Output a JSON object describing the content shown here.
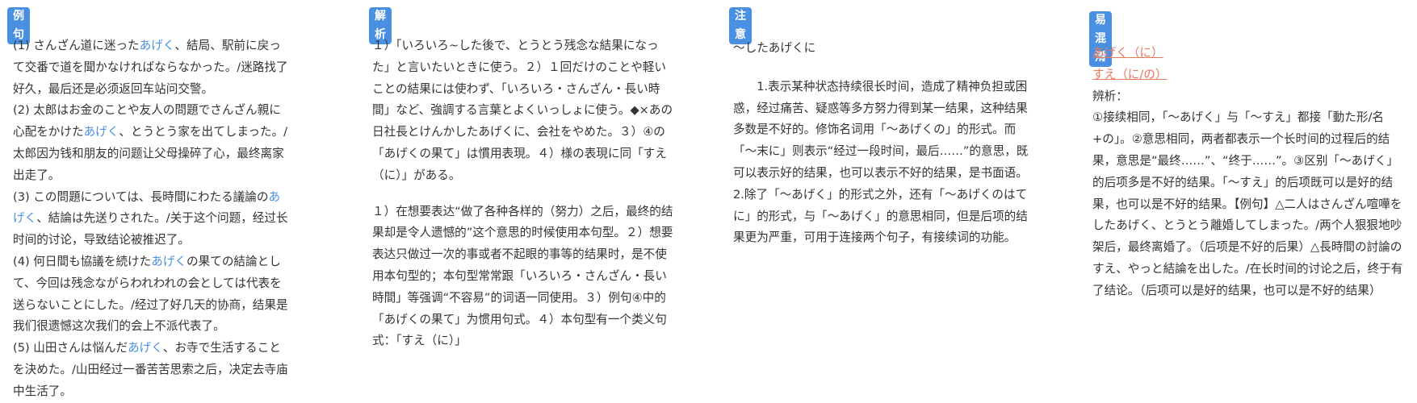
{
  "colors": {
    "tag_bg": "#4a90e2",
    "highlight": "#4a90e2",
    "link": "#e8775a"
  },
  "col1": {
    "tag": "例句",
    "ex1": {
      "a": "(1) さんざん道に迷った",
      "hl": "あげく",
      "b": "、結局、駅前に戻って交番で道を聞かなければならなかった。/迷路找了好久，最后还是必须返回车站问交警。"
    },
    "ex2": {
      "a": "(2) 太郎はお金のことや友人の問題でさんざん親に心配をかけた",
      "hl": "あげく",
      "b": "、とうとう家を出てしまった。/太郎因为钱和朋友的问题让父母操碎了心，最终离家出走了。"
    },
    "ex3": {
      "a": "(3) この問題については、長時間にわたる議論の",
      "hl": "あげく",
      "b": "、結論は先送りされた。/关于这个问题，经过长时间的讨论，导致结论被推迟了。"
    },
    "ex4": {
      "a": "(4) 何日間も協議を続けた",
      "hl": "あげく",
      "b": "の果ての結論として、今回は残念ながらわれわれの会としては代表を送らないことにした。/经过了好几天的协商，结果是我们很遗憾这次我们的会上不派代表了。"
    },
    "ex5": {
      "a": "(5) 山田さんは悩んだ",
      "hl": "あげく",
      "b": "、お寺で生活することを決めた。/山田经过一番苦苦思索之后，决定去寺庙中生活了。"
    }
  },
  "col2": {
    "tag": "解析",
    "p1": "１）「いろいろ~した後で、とうとう残念な結果になった」と言いたいときに使う。２）１回だけのことや軽いことの結果には使わず、「いろいろ・さんざん・長い時間」など、強調する言葉とよくいっしょに使う。◆×あの日社長とけんかしたあげくに、会社をやめた。３）④の「あげくの果て」は慣用表現。４）様の表現に同「すえ（に）」がある。",
    "p2": "１）在想要表达“做了各种各样的（努力）之后，最终的结果却是令人遗憾的”这个意思的时候使用本句型。２）想要表达只做过一次的事或者不起眼的事等的结果时，是不使用本句型的；本句型常常跟「いろいろ・さんざん・長い時間」等强调“不容易”的词语一同使用。３）例句④中的「あげくの果て」为惯用句式。４）本句型有一个类义句式：「すえ（に）」"
  },
  "col3": {
    "tag": "注意",
    "heading": "～したあげくに",
    "p1": "1.表示某种状态持续很长时间，造成了精神负担或困惑，经过痛苦、疑惑等多方努力得到某一结果，这种结果多数是不好的。修饰名词用「～あげくの」的形式。而「～末に」则表示“经过一段时间，最后……”的意思，既可以表示好的结果，也可以表示不好的结果，是书面语。",
    "p2": "2.除了「～あげく」的形式之外，还有「～あげくのはてに」的形式，与「～あげく」的意思相同，但是后项的结果更为严重，可用于连接两个句子，有接续词的功能。"
  },
  "col4": {
    "tag": "易混淆",
    "link1": "あげく（に）",
    "link2": "すえ（に/の）",
    "label": "辨析：",
    "p1": "①接续相同，「～あげく」与「～すえ」都接「動た形/名+の」。②意思相同，两者都表示一个长时间的过程后的结果，意思是“最终……”、“终于……”。③区别「～あげく」的后项多是不好的结果。「～すえ」的后项既可以是好的结果，也可以是不好的结果。【例句】△二人はさんざん喧嘩をしたあげく、とうとう離婚してしまった。/两个人狠狠地吵架后，最终离婚了。（后项是不好的后果）△長時間の討論のすえ、やっと結論を出した。/在长时间的讨论之后，终于有了结论。（后项可以是好的结果，也可以是不好的结果）"
  }
}
